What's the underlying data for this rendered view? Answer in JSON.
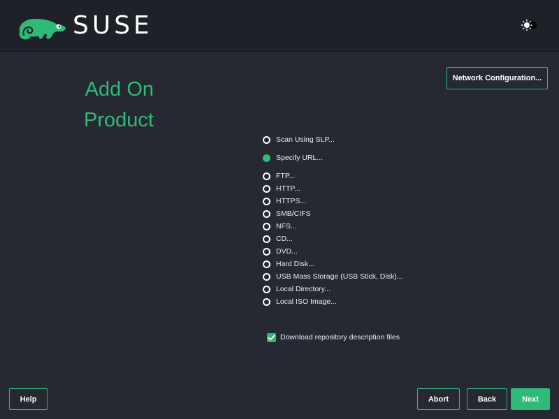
{
  "header": {
    "brand": "SUSE",
    "logo_icon": "suse-chameleon-icon",
    "theme_toggle_icon": "theme-toggle-icon"
  },
  "page": {
    "title_line1": "Add On",
    "title_line2": "Product"
  },
  "buttons": {
    "network_configuration": "Network Configuration...",
    "help": "Help",
    "abort": "Abort",
    "back": "Back",
    "next": "Next"
  },
  "sources": {
    "scan_slp": "Scan Using SLP...",
    "specify_url": "Specify URL...",
    "selected": "Specify URL...",
    "options": [
      "FTP...",
      "HTTP...",
      "HTTPS...",
      "SMB/CIFS",
      "NFS...",
      "CD...",
      "DVD...",
      "Hard Disk...",
      "USB Mass Storage (USB Stick, Disk)...",
      "Local Directory...",
      "Local ISO Image..."
    ]
  },
  "download_repo_files": {
    "label": "Download repository description files",
    "checked": true
  },
  "colors": {
    "accent": "#30ba78",
    "background": "#272932",
    "header": "#1f2128"
  }
}
